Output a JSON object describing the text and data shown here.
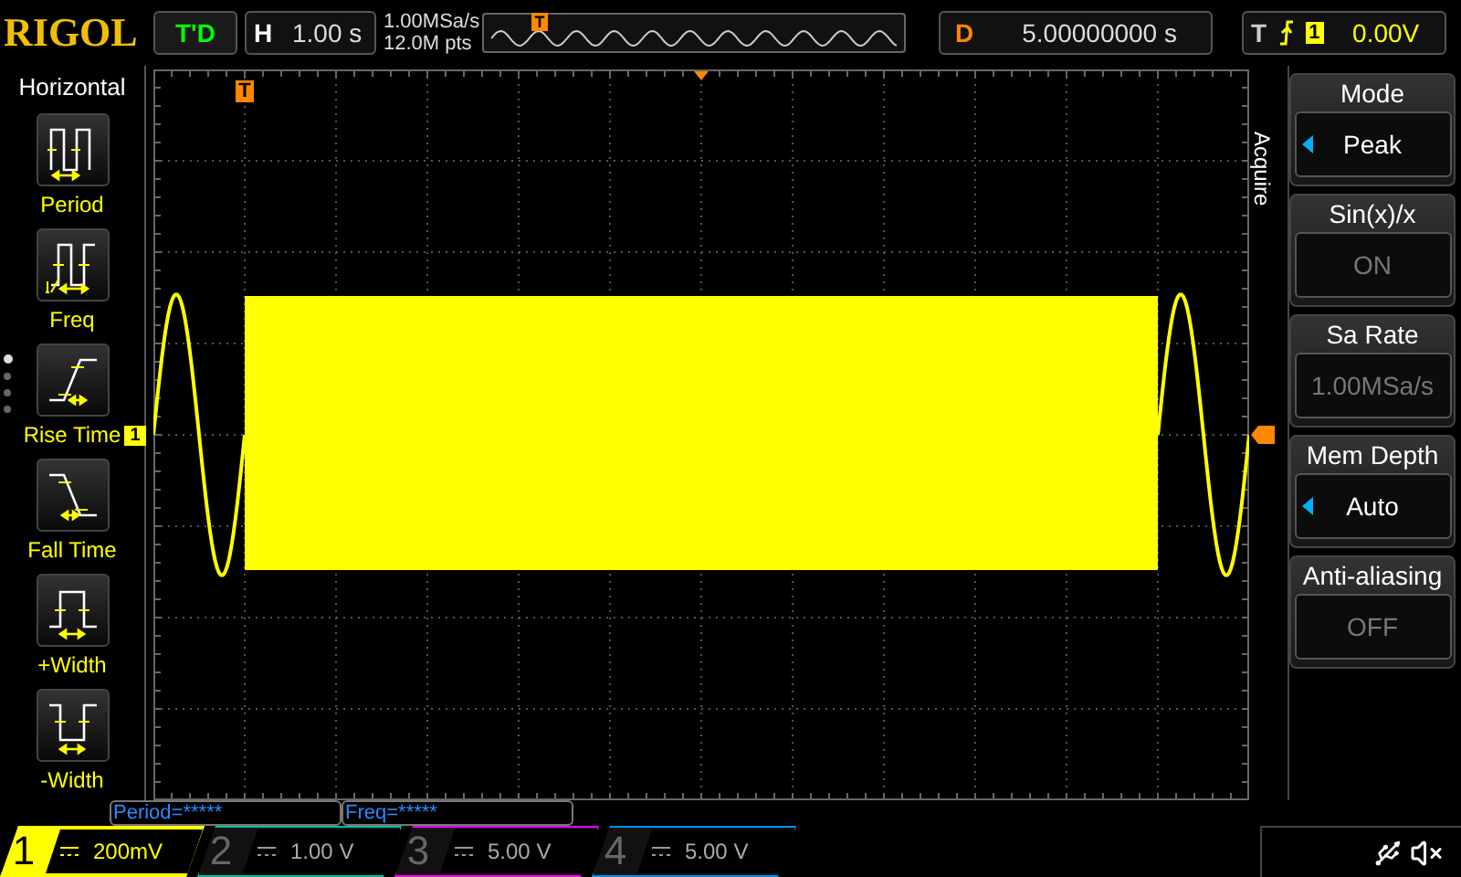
{
  "brand": "RIGOL",
  "trigger_status": "T'D",
  "horizontal": {
    "label": "H",
    "timebase": "1.00 s"
  },
  "acquisition": {
    "sample_rate": "1.00MSa/s",
    "points": "12.0M pts"
  },
  "overview": {
    "marker": "T"
  },
  "delay": {
    "label": "D",
    "value": "5.00000000 s"
  },
  "trigger": {
    "label": "T",
    "channel": "1",
    "level": "0.00V"
  },
  "left_menu": {
    "title": "Horizontal",
    "items": [
      {
        "kind": "period",
        "label": "Period"
      },
      {
        "kind": "freq",
        "label": "Freq"
      },
      {
        "kind": "rise",
        "label": "Rise Time"
      },
      {
        "kind": "fall",
        "label": "Fall Time"
      },
      {
        "kind": "pwidth",
        "label": "+Width"
      },
      {
        "kind": "nwidth",
        "label": "-Width"
      }
    ],
    "pages": [
      {
        "selected": true
      },
      {
        "selected": false
      },
      {
        "selected": false
      },
      {
        "selected": false
      }
    ]
  },
  "screen": {
    "trigger_marker": "T",
    "channel_marker": "1"
  },
  "right_menu": {
    "title": "Acquire",
    "items": [
      {
        "label": "Mode",
        "value": "Peak",
        "disabled": false
      },
      {
        "label": "Sin(x)/x",
        "value": "ON",
        "disabled": true
      },
      {
        "label": "Sa Rate",
        "value": "1.00MSa/s",
        "disabled": true
      },
      {
        "label": "Mem Depth",
        "value": "Auto",
        "disabled": false
      },
      {
        "label": "Anti-aliasing",
        "value": "OFF",
        "disabled": true
      }
    ]
  },
  "measurements": [
    "Period=*****",
    "Freq=*****"
  ],
  "channels": [
    {
      "number": "1",
      "scale": "200mV",
      "selected": true,
      "color": "#ffff00"
    },
    {
      "number": "2",
      "scale": "1.00 V",
      "selected": false,
      "color": "#00c0a0"
    },
    {
      "number": "3",
      "scale": "5.00 V",
      "selected": false,
      "color": "#ff00ff"
    },
    {
      "number": "4",
      "scale": "5.00 V",
      "selected": false,
      "color": "#0090ff"
    }
  ]
}
